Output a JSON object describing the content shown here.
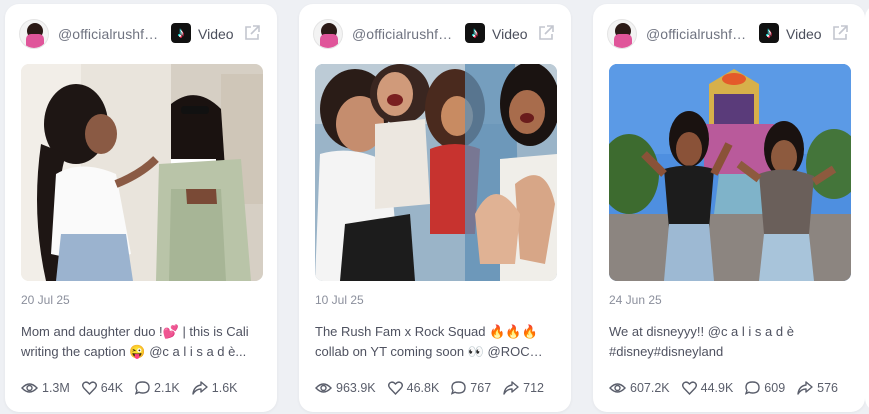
{
  "posts": [
    {
      "handle": "@officialrushfa...",
      "type": "Video",
      "date": "20 Jul 25",
      "caption_line1": "Mom and daughter duo !💕 | this is Cali",
      "caption_line2": "writing the caption 😜 @c a l i s a d è...",
      "views": "1.3M",
      "likes": "64K",
      "comments": "2.1K",
      "shares": "1.6K"
    },
    {
      "handle": "@officialrushfa...",
      "type": "Video",
      "date": "10 Jul 25",
      "caption_line1": "The Rush Fam x Rock Squad 🔥🔥🔥",
      "caption_line2": "collab on YT coming soon 👀 @ROCK...",
      "views": "963.9K",
      "likes": "46.8K",
      "comments": "767",
      "shares": "712"
    },
    {
      "handle": "@officialrushfa...",
      "type": "Video",
      "date": "24 Jun 25",
      "caption_line1": "We at disneyyy!! @c a l i s a d è",
      "caption_line2": "#disney#disneyland",
      "views": "607.2K",
      "likes": "44.9K",
      "comments": "609",
      "shares": "576"
    }
  ],
  "colors": {
    "background": "#eef0f4",
    "card": "#ffffff",
    "text": "#4f5260",
    "muted": "#8b8f9c"
  },
  "icons": [
    "tiktok-logo",
    "external-link-icon",
    "eye-icon",
    "heart-icon",
    "comment-icon",
    "share-icon"
  ]
}
